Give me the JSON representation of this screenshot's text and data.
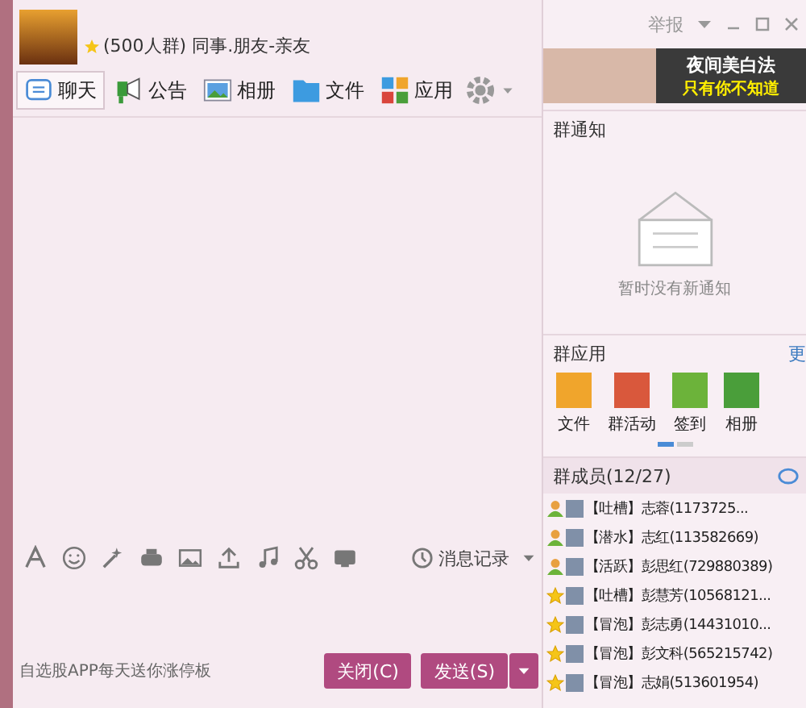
{
  "header": {
    "group_info": "(500人群) 同事.朋友-亲友",
    "window_controls": [
      "举报"
    ]
  },
  "tabs": [
    {
      "label": "聊天",
      "selected": true
    },
    {
      "label": "公告",
      "selected": false
    },
    {
      "label": "相册",
      "selected": false
    },
    {
      "label": "文件",
      "selected": false
    },
    {
      "label": "应用",
      "selected": false
    }
  ],
  "ad_banner": {
    "lines": [
      "夜间美白法",
      "只有你不知道"
    ]
  },
  "toolbar": {
    "history_label": "消息记录"
  },
  "input": {
    "promo": "自选股APP每天送你涨停板"
  },
  "buttons": {
    "close": "关闭(C)",
    "send": "发送(S)"
  },
  "notice": {
    "title": "群通知",
    "empty_text": "暂时没有新通知"
  },
  "group_apps": {
    "title": "群应用",
    "more": "更",
    "apps": [
      {
        "label": "文件",
        "color": "#f0a52c"
      },
      {
        "label": "群活动",
        "color": "#d9583c"
      },
      {
        "label": "签到",
        "color": "#6cb33a"
      },
      {
        "label": "相册",
        "color": "#4a9e3a"
      }
    ]
  },
  "members": {
    "title": "群成员(12/27)",
    "items": [
      {
        "kind": "person",
        "text": "【吐槽】志蓉(1173725..."
      },
      {
        "kind": "person",
        "text": "【潜水】志红(113582669)"
      },
      {
        "kind": "person",
        "text": "【活跃】彭思红(729880389)"
      },
      {
        "kind": "star",
        "text": "【吐槽】彭慧芳(10568121..."
      },
      {
        "kind": "star",
        "text": "【冒泡】彭志勇(14431010..."
      },
      {
        "kind": "star",
        "text": "【冒泡】彭文科(565215742)"
      },
      {
        "kind": "star",
        "text": "【冒泡】志娟(513601954)"
      }
    ]
  }
}
